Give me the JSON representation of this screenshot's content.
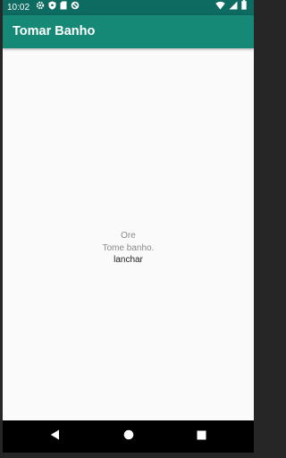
{
  "status_bar": {
    "time": "10:02",
    "left_icons": [
      "gear-icon",
      "shield-icon",
      "sd-card-icon",
      "no-sync-icon"
    ],
    "right_icons": [
      "wifi-icon",
      "signal-icon",
      "battery-icon"
    ]
  },
  "app_bar": {
    "title": "Tomar Banho"
  },
  "list": {
    "items": [
      {
        "label": "Ore"
      },
      {
        "label": "Tome banho."
      },
      {
        "label": "lanchar"
      }
    ]
  },
  "nav_bar": {
    "buttons": [
      "back-icon",
      "home-icon",
      "recents-icon"
    ]
  },
  "colors": {
    "status_bar": "#0d6b61",
    "app_bar": "#158876",
    "background": "#fafafa",
    "nav_bar": "#000000"
  }
}
